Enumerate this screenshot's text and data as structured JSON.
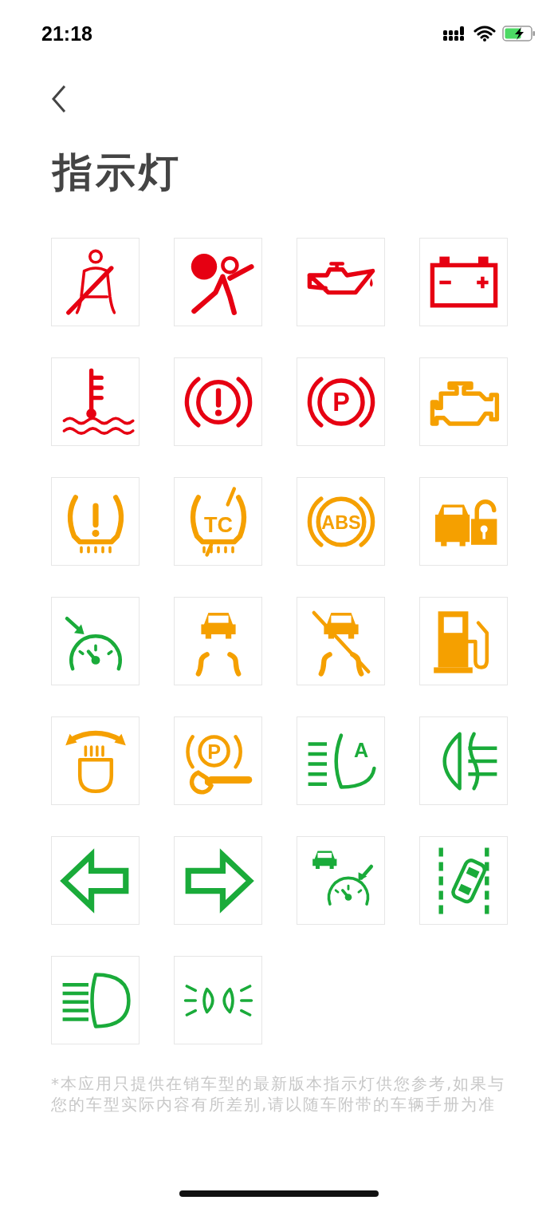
{
  "status_bar": {
    "time": "21:18"
  },
  "title": "指示灯",
  "indicators": [
    {
      "kind": "seatbelt",
      "color": "#e60012"
    },
    {
      "kind": "airbag",
      "color": "#e60012"
    },
    {
      "kind": "oil",
      "color": "#e60012"
    },
    {
      "kind": "battery",
      "color": "#e60012"
    },
    {
      "kind": "coolant",
      "color": "#e60012"
    },
    {
      "kind": "brake",
      "color": "#e60012"
    },
    {
      "kind": "parking_brake",
      "color": "#e60012",
      "label": "P"
    },
    {
      "kind": "engine",
      "color": "#f5a000"
    },
    {
      "kind": "tpms",
      "color": "#f5a000"
    },
    {
      "kind": "traction_off",
      "color": "#f5a000",
      "label": "TC"
    },
    {
      "kind": "abs",
      "color": "#f5a000",
      "label": "ABS"
    },
    {
      "kind": "car_lock",
      "color": "#f5a000"
    },
    {
      "kind": "cruise",
      "color": "#1aab3a"
    },
    {
      "kind": "skid",
      "color": "#f5a000"
    },
    {
      "kind": "skid_off",
      "color": "#f5a000"
    },
    {
      "kind": "fuel",
      "color": "#f5a000"
    },
    {
      "kind": "headlight_level",
      "color": "#f5a000"
    },
    {
      "kind": "epb_fault",
      "color": "#f5a000",
      "label": "P"
    },
    {
      "kind": "auto_headlight",
      "color": "#1aab3a",
      "label": "A"
    },
    {
      "kind": "rear_fog",
      "color": "#1aab3a"
    },
    {
      "kind": "turn_left",
      "color": "#1aab3a"
    },
    {
      "kind": "turn_right",
      "color": "#1aab3a"
    },
    {
      "kind": "adaptive_cruise",
      "color": "#1aab3a"
    },
    {
      "kind": "lane_keep",
      "color": "#1aab3a"
    },
    {
      "kind": "high_beam",
      "color": "#1aab3a"
    },
    {
      "kind": "parking_lights",
      "color": "#1aab3a"
    }
  ],
  "footnote": "*本应用只提供在销车型的最新版本指示灯供您参考,如果与您的车型实际内容有所差别,请以随车附带的车辆手册为准"
}
